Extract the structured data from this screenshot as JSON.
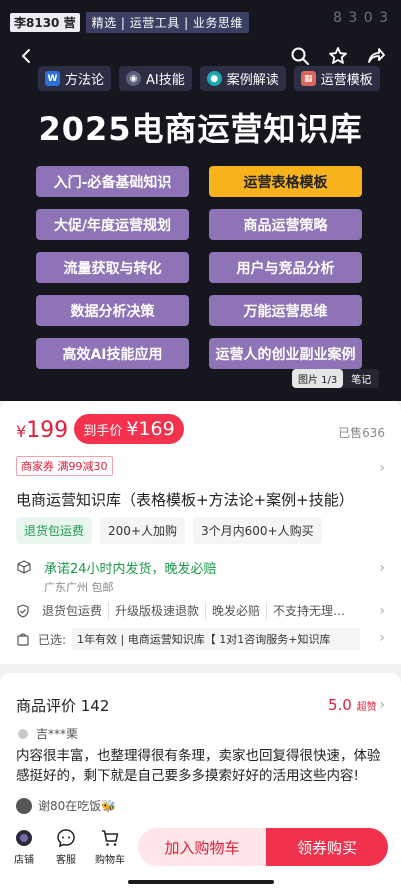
{
  "hero": {
    "brand": "李8130 营",
    "tagline": "精选 | 运营工具 | 业务思维",
    "top_right": "8 3 0 3",
    "categories": [
      "方法论",
      "AI技能",
      "案例解读",
      "运营模板"
    ],
    "title": "2025电商运营知识库",
    "pills": [
      "入门-必备基础知识",
      "运营表格模板",
      "大促/年度运营规划",
      "商品运营策略",
      "流量获取与转化",
      "用户与竞品分析",
      "数据分析决策",
      "万能运营思维",
      "高效AI技能应用",
      "运营人的创业副业案例"
    ],
    "image_counter": "图片 1/3",
    "notes": "笔记"
  },
  "price": {
    "currency": "¥",
    "value": "199",
    "coupon_label": "到手价",
    "coupon_currency": "¥",
    "coupon_value": "169",
    "sold": "已售636"
  },
  "store_coupon": "商家券 满99减30",
  "product_title": "电商运营知识库（表格模板+方法论+案例+技能）",
  "tags": [
    "退货包运费",
    "200+人加购",
    "3个月内600+人购买"
  ],
  "shipping": {
    "main": "承诺24小时内发货，晚发必赔",
    "sub": "广东广州 包邮"
  },
  "services": [
    "退货包运费",
    "升级版极速退款",
    "晚发必赔",
    "不支持无理…"
  ],
  "selected": {
    "label": "已选:",
    "value": "1年有效 | 电商运营知识库【 1对1咨询服务+知识库"
  },
  "reviews": {
    "title": "商品评价 142",
    "score": "5.0",
    "score_label": "超赞",
    "reviewer": "吉***栗",
    "text": "内容很丰富，也整理得很有条理，卖家也回复得很快速，体验感挺好的，剩下就是自己要多多摸索好好的活用这些内容!",
    "sub_reviewer": "谢80在吃饭🐝"
  },
  "bottom_bar": {
    "store": "店铺",
    "service": "客服",
    "cart": "购物车",
    "add_cart": "加入购物车",
    "buy": "领券购买"
  },
  "colors": {
    "accent_red": "#e21e3a",
    "pill_purple": "#8e74b6",
    "pill_highlight": "#f7b21c",
    "hero_bg": "#16161f",
    "green": "#1c9b4a"
  }
}
